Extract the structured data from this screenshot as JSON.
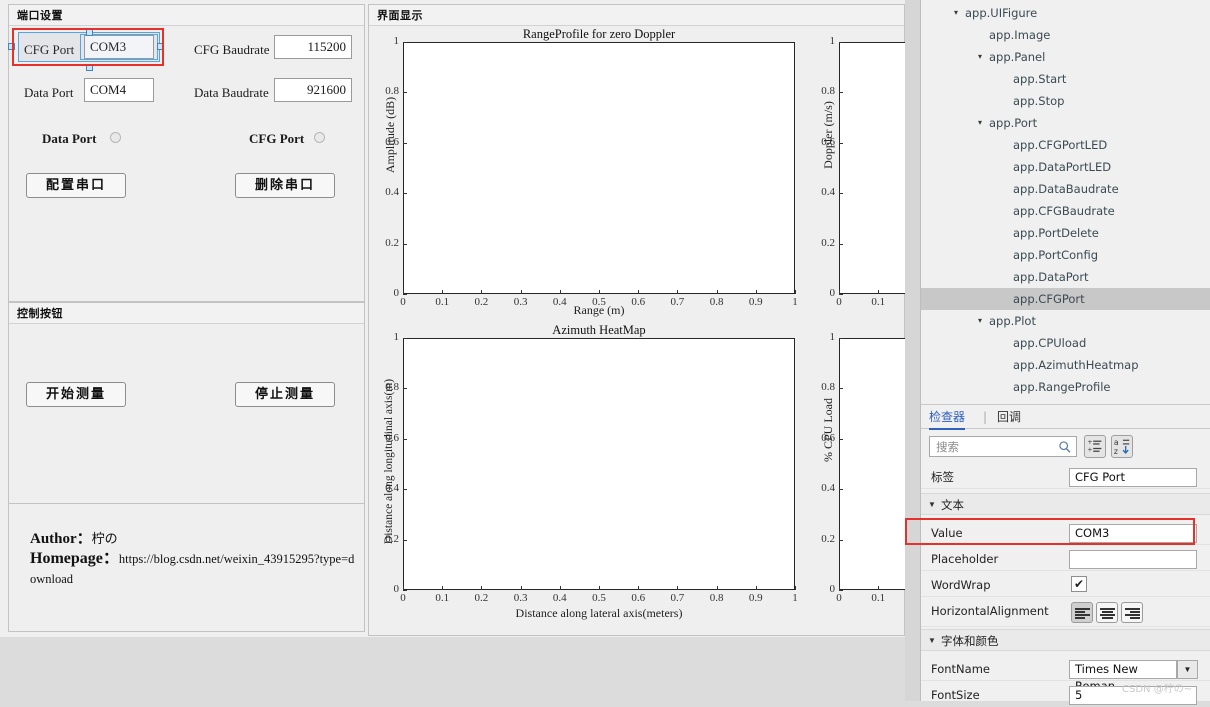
{
  "panels": {
    "port_settings_title": "端口设置",
    "control_title": "控制按钮",
    "display_title": "界面显示"
  },
  "port_form": {
    "cfg_port_label": "CFG Port",
    "cfg_port_value": "COM3",
    "data_port_label": "Data Port",
    "data_port_value": "COM4",
    "cfg_baud_label": "CFG Baudrate",
    "cfg_baud_value": "115200",
    "data_baud_label": "Data Baudrate",
    "data_baud_value": "921600",
    "lamp_data_port_label": "Data Port",
    "lamp_cfg_port_label": "CFG Port",
    "config_button": "配置串口",
    "delete_button": "删除串口"
  },
  "control_form": {
    "start_button": "开始测量",
    "stop_button": "停止测量"
  },
  "info": {
    "author_key": "Author：",
    "author_value": "柠の",
    "homepage_key": "Homepage：",
    "homepage_value": "https://blog.csdn.net/weixin_43915295?type=download"
  },
  "chart_data": [
    {
      "type": "line",
      "title": "RangeProfile for zero Doppler",
      "xlabel": "Range (m)",
      "ylabel": "Amplitude (dB)",
      "xlim": [
        0,
        1
      ],
      "ylim": [
        0,
        1
      ],
      "xticks": [
        "0",
        "0.1",
        "0.2",
        "0.3",
        "0.4",
        "0.5",
        "0.6",
        "0.7",
        "0.8",
        "0.9",
        "1"
      ],
      "yticks": [
        "0",
        "0.2",
        "0.4",
        "0.6",
        "0.8",
        "1"
      ],
      "series": [],
      "grid": false,
      "legend": null
    },
    {
      "type": "line",
      "title": "",
      "xlabel": "",
      "ylabel": "Doppler (m/s)",
      "xlim": [
        0,
        1
      ],
      "ylim": [
        0,
        1
      ],
      "xticks": [
        "0",
        "0.1"
      ],
      "yticks": [
        "0",
        "0.2",
        "0.4",
        "0.6",
        "0.8",
        "1"
      ],
      "series": [],
      "grid": false,
      "legend": null
    },
    {
      "type": "heatmap",
      "title": "Azimuth HeatMap",
      "xlabel": "Distance along lateral axis(meters)",
      "ylabel": "Distance along longitudinal axis(m)",
      "xlim": [
        0,
        1
      ],
      "ylim": [
        0,
        1
      ],
      "xticks": [
        "0",
        "0.1",
        "0.2",
        "0.3",
        "0.4",
        "0.5",
        "0.6",
        "0.7",
        "0.8",
        "0.9",
        "1"
      ],
      "yticks": [
        "0",
        "0.2",
        "0.4",
        "0.6",
        "0.8",
        "1"
      ],
      "series": [],
      "grid": false,
      "legend": null
    },
    {
      "type": "line",
      "title": "",
      "xlabel": "",
      "ylabel": "% CPU Load",
      "xlim": [
        0,
        1
      ],
      "ylim": [
        0,
        1
      ],
      "xticks": [
        "0",
        "0.1"
      ],
      "yticks": [
        "0",
        "0.2",
        "0.4",
        "0.6",
        "0.8",
        "1"
      ],
      "series": [],
      "grid": false,
      "legend": null
    }
  ],
  "tree": {
    "items": [
      {
        "label": "app.UIFigure",
        "indent": 0,
        "arrow": "▾",
        "selected": false
      },
      {
        "label": "app.Image",
        "indent": 1,
        "arrow": "",
        "selected": false
      },
      {
        "label": "app.Panel",
        "indent": 1,
        "arrow": "▾",
        "selected": false
      },
      {
        "label": "app.Start",
        "indent": 2,
        "arrow": "",
        "selected": false
      },
      {
        "label": "app.Stop",
        "indent": 2,
        "arrow": "",
        "selected": false
      },
      {
        "label": "app.Port",
        "indent": 1,
        "arrow": "▾",
        "selected": false
      },
      {
        "label": "app.CFGPortLED",
        "indent": 2,
        "arrow": "",
        "selected": false
      },
      {
        "label": "app.DataPortLED",
        "indent": 2,
        "arrow": "",
        "selected": false
      },
      {
        "label": "app.DataBaudrate",
        "indent": 2,
        "arrow": "",
        "selected": false
      },
      {
        "label": "app.CFGBaudrate",
        "indent": 2,
        "arrow": "",
        "selected": false
      },
      {
        "label": "app.PortDelete",
        "indent": 2,
        "arrow": "",
        "selected": false
      },
      {
        "label": "app.PortConfig",
        "indent": 2,
        "arrow": "",
        "selected": false
      },
      {
        "label": "app.DataPort",
        "indent": 2,
        "arrow": "",
        "selected": false
      },
      {
        "label": "app.CFGPort",
        "indent": 2,
        "arrow": "",
        "selected": true
      },
      {
        "label": "app.Plot",
        "indent": 1,
        "arrow": "▾",
        "selected": false
      },
      {
        "label": "app.CPUload",
        "indent": 2,
        "arrow": "",
        "selected": false
      },
      {
        "label": "app.AzimuthHeatmap",
        "indent": 2,
        "arrow": "",
        "selected": false
      },
      {
        "label": "app.RangeProfile",
        "indent": 2,
        "arrow": "",
        "selected": false
      }
    ]
  },
  "inspector": {
    "tab_inspector": "检查器",
    "tab_separator": "|",
    "tab_callback": "回调",
    "search_placeholder": "搜索",
    "search_value": "搜索",
    "group_icon_name": "group-list-icon",
    "sort_icon_name": "sort-az-icon",
    "rows": {
      "tag_label": "标签",
      "tag_value": "CFG Port",
      "section_text": "文本",
      "value_label": "Value",
      "value_value": "COM3",
      "placeholder_label": "Placeholder",
      "placeholder_value": "",
      "wordwrap_label": "WordWrap",
      "wordwrap_checked": "✔",
      "halign_label": "HorizontalAlignment",
      "section_font": "字体和颜色",
      "fontname_label": "FontName",
      "fontname_value": "Times New Roman",
      "fontsize_label": "FontSize",
      "fontsize_value": "5"
    }
  },
  "watermark": "CSDN @柠の~",
  "colors": {
    "highlight_red": "#e8302a",
    "selection_blue": "#56a5e0",
    "tab_active": "#2f5fbf",
    "tree_selected_bg": "#c8c8c8"
  }
}
